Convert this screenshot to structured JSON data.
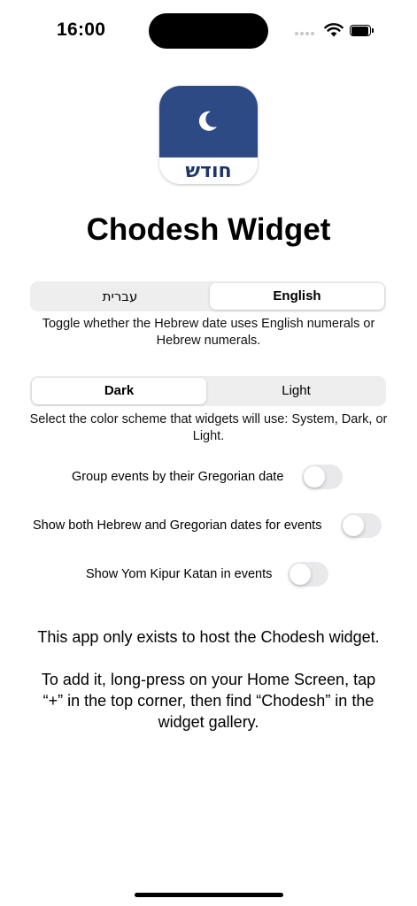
{
  "status_bar": {
    "time": "16:00"
  },
  "app": {
    "icon_label": "חודש",
    "icon_colors": {
      "top": "#2e4a85",
      "bottom": "#ffffff"
    },
    "title": "Chodesh Widget"
  },
  "numerals_segment": {
    "options": [
      "עברית",
      "English"
    ],
    "selected": "English",
    "caption": "Toggle whether the Hebrew date uses English numerals or Hebrew numerals."
  },
  "scheme_segment": {
    "options": [
      "Dark",
      "Light"
    ],
    "selected": "Dark",
    "caption": "Select the color scheme that widgets will use: System, Dark, or Light."
  },
  "toggles": [
    {
      "label": "Group events by their Gregorian date",
      "on": false
    },
    {
      "label": "Show both Hebrew and Gregorian dates for events",
      "on": false
    },
    {
      "label": "Show Yom Kipur Katan in events",
      "on": false
    }
  ],
  "info": {
    "line1": "This app only exists to host the Chodesh widget.",
    "line2": "To add it, long-press on your Home Screen, tap “+” in the top corner, then find “Chodesh” in the widget gallery."
  }
}
